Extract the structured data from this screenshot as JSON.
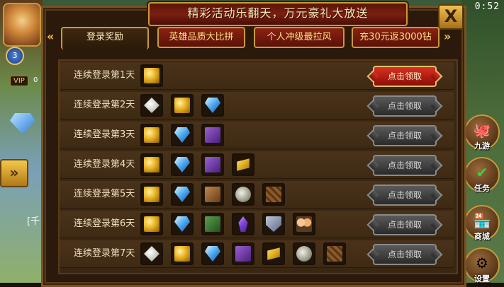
{
  "title": "精彩活动乐翻天，万元豪礼大放送",
  "close_label": "X",
  "clock": "0:52",
  "left_hud": {
    "level": "3",
    "vip_label": "VIP",
    "vip_value": "0",
    "side_text": "[千"
  },
  "right_hud": {
    "buttons": [
      {
        "label": "九游",
        "glyph": "🐙"
      },
      {
        "label": "任务",
        "glyph": "✔"
      },
      {
        "label": "商城",
        "glyph": "🏪"
      },
      {
        "label": "设置",
        "glyph": "⚙"
      }
    ]
  },
  "tabs": [
    {
      "label": "登录奖励",
      "active": true
    },
    {
      "label": "英雄品质大比拼",
      "active": false
    },
    {
      "label": "个人冲级最拉风",
      "active": false
    },
    {
      "label": "充30元返3000钻",
      "active": false
    }
  ],
  "rows": [
    {
      "label": "连续登录第1天",
      "items": [
        "coin"
      ],
      "button": "点击领取",
      "claimable": true
    },
    {
      "label": "连续登录第2天",
      "items": [
        "silver",
        "coin",
        "gem"
      ],
      "button": "点击领取",
      "claimable": false
    },
    {
      "label": "连续登录第3天",
      "items": [
        "coin",
        "gem",
        "book"
      ],
      "button": "点击领取",
      "claimable": false
    },
    {
      "label": "连续登录第4天",
      "items": [
        "coin",
        "gem",
        "book",
        "gold-bar"
      ],
      "button": "点击领取",
      "claimable": false
    },
    {
      "label": "连续登录第5天",
      "items": [
        "coin",
        "gem",
        "bookbrown",
        "stone",
        "wood"
      ],
      "button": "点击领取",
      "claimable": false
    },
    {
      "label": "连续登录第6天",
      "items": [
        "coin",
        "gem",
        "bookgreen",
        "crystal",
        "shield",
        "heroes"
      ],
      "button": "点击领取",
      "claimable": false
    },
    {
      "label": "连续登录第7天",
      "items": [
        "silver",
        "coin",
        "gem",
        "book",
        "gold-bar",
        "stone",
        "wood"
      ],
      "button": "点击领取",
      "claimable": false
    }
  ]
}
